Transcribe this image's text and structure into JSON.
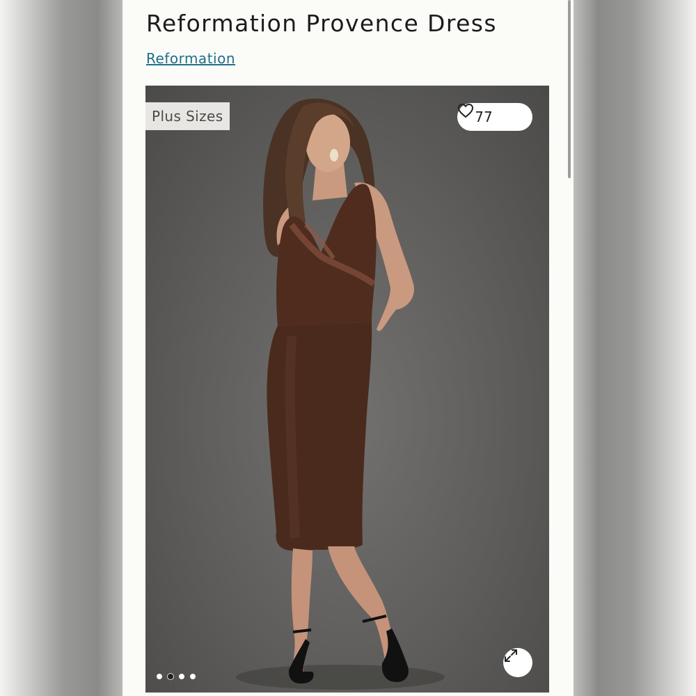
{
  "listing": {
    "title": "Reformation Provence Dress",
    "brand_link": "Reformation"
  },
  "photo": {
    "badge": "Plus Sizes",
    "likes": "77",
    "like_icon": "heart-outline-icon",
    "expand_icon": "expand-arrows-icon",
    "carousel_dots": 4,
    "active_dot_index": 1
  },
  "colors": {
    "link": "#1f6f8b",
    "dress": "#4a2a1c",
    "background": "#5e5d5b"
  }
}
